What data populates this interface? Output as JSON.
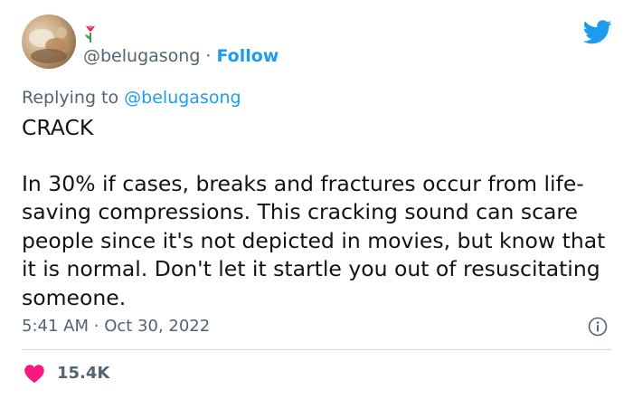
{
  "author": {
    "handle": "@belugasong",
    "separator": "·",
    "follow_label": "Follow",
    "avatar_icon": "user-avatar",
    "badge_icon": "tulip-icon"
  },
  "replying": {
    "prefix": "Replying to",
    "mention": "@belugasong"
  },
  "tweet": {
    "paragraphs": [
      "CRACK",
      "In 30% if cases, breaks and fractures occur from life-saving compressions. This cracking sound can scare people since it's not depicted in movies, but know that it is normal. Don't let it startle you out of resuscitating someone."
    ],
    "time": "5:41 AM",
    "date_separator": "·",
    "date": "Oct 30, 2022"
  },
  "stats": {
    "likes": "15.4K"
  },
  "colors": {
    "accent": "#1d9bf0",
    "heart": "#f91880",
    "secondary_text": "#536471",
    "divider": "#cfd9de"
  }
}
